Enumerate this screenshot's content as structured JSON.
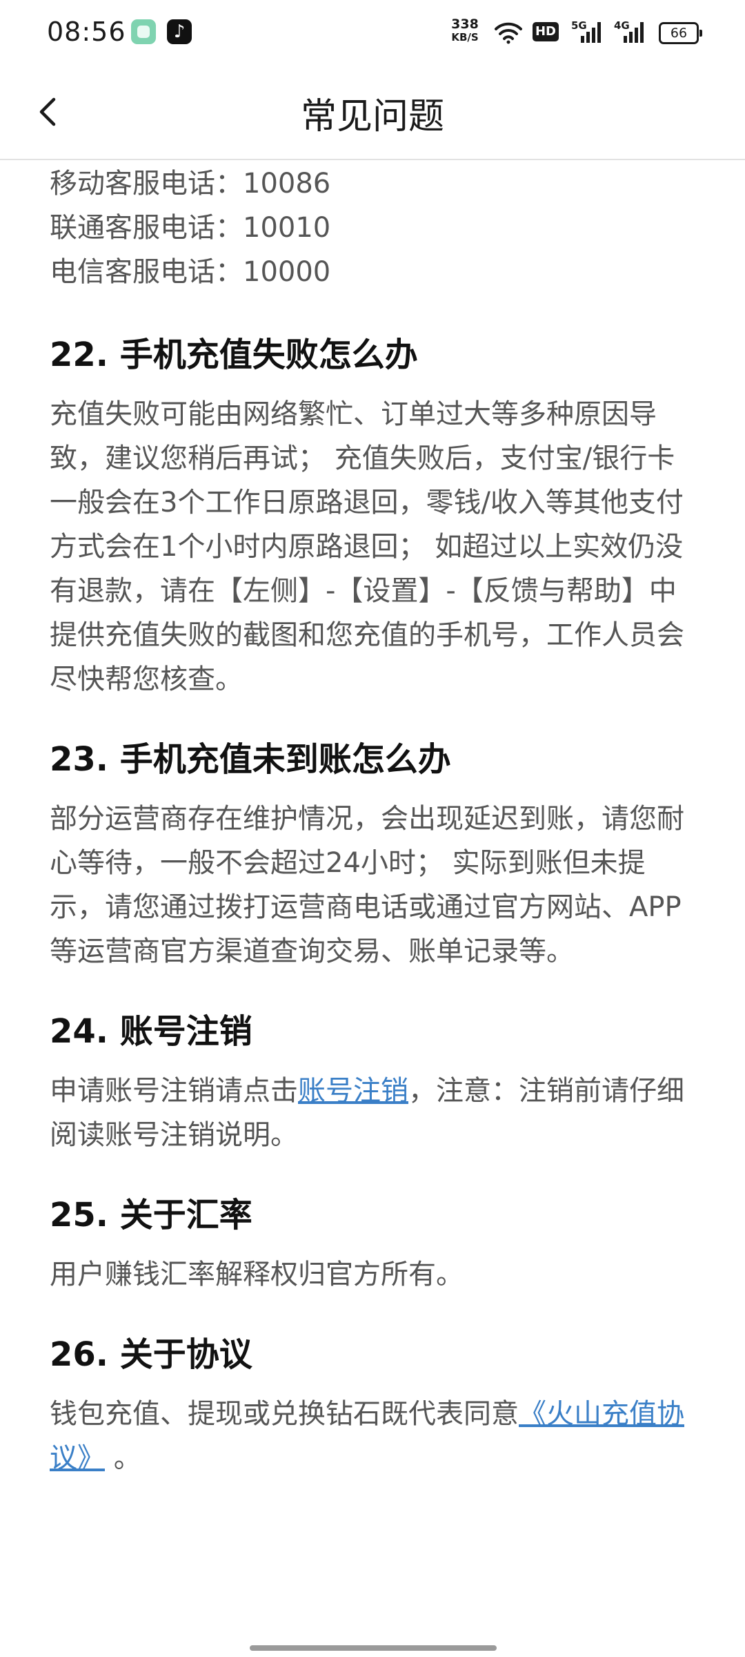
{
  "status_bar": {
    "time": "08:56",
    "net_speed_value": "338",
    "net_speed_unit": "KB/S",
    "hd_label": "HD",
    "sim1_label": "5G",
    "sim2_label": "4G",
    "battery": "66"
  },
  "nav": {
    "title": "常见问题"
  },
  "contacts": [
    "移动客服电话：10086",
    "联通客服电话：10010",
    "电信客服电话：10000"
  ],
  "faq": {
    "q22": {
      "title": "22. 手机充值失败怎么办",
      "body": "充值失败可能由网络繁忙、订单过大等多种原因导致，建议您稍后再试； 充值失败后，支付宝/银行卡一般会在3个工作日原路退回，零钱/收入等其他支付方式会在1个小时内原路退回； 如超过以上实效仍没有退款，请在【左侧】-【设置】-【反馈与帮助】中提供充值失败的截图和您充值的手机号，工作人员会尽快帮您核查。"
    },
    "q23": {
      "title": "23. 手机充值未到账怎么办",
      "body": "部分运营商存在维护情况，会出现延迟到账，请您耐心等待，一般不会超过24小时； 实际到账但未提示，请您通过拨打运营商电话或通过官方网站、APP等运营商官方渠道查询交易、账单记录等。"
    },
    "q24": {
      "title": "24. 账号注销",
      "body_before": "申请账号注销请点击",
      "link": "账号注销",
      "body_after": "，注意：注销前请仔细阅读账号注销说明。"
    },
    "q25": {
      "title": "25. 关于汇率",
      "body": "用户赚钱汇率解释权归官方所有。"
    },
    "q26": {
      "title": "26. 关于协议",
      "body_before": "钱包充值、提现或兑换钻石既代表同意",
      "link": "《火山充值协议》",
      "body_after": " 。"
    }
  },
  "colors": {
    "link": "#3a7fc7",
    "body_text": "#555555",
    "title_text": "#111111"
  }
}
